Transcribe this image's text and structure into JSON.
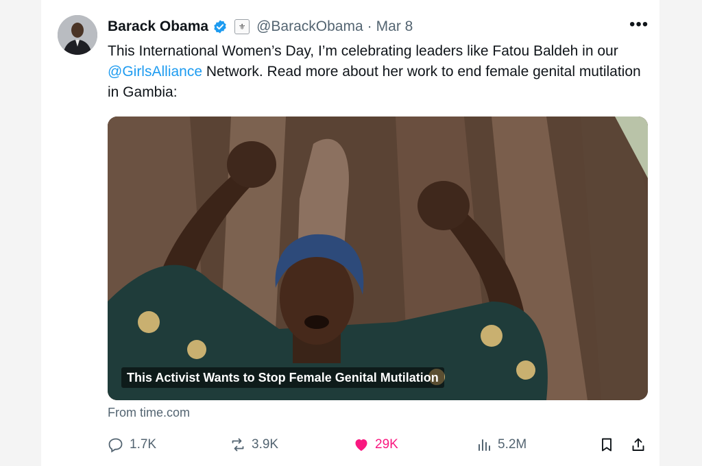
{
  "tweet": {
    "author_name": "Barack Obama",
    "handle": "@BarackObama",
    "separator": "·",
    "date": "Mar 8",
    "more_label": "•••",
    "text_before_mention": "This International Women’s Day, I’m celebrating leaders like Fatou Baldeh in our ",
    "mention": "@GirlsAlliance",
    "text_after_mention": " Network. Read more about her work to end female genital mutilation in Gambia:"
  },
  "media": {
    "caption": "This Activist Wants to Stop Female Genital Mutilation",
    "source": "From time.com"
  },
  "actions": {
    "replies": "1.7K",
    "reposts": "3.9K",
    "likes": "29K",
    "views": "5.2M"
  },
  "colors": {
    "accent": "#1d9bf0",
    "like": "#f91880",
    "muted": "#536471"
  },
  "icons": {
    "verified": "verified-badge-icon",
    "government": "government-seal-icon",
    "reply": "reply-icon",
    "repost": "repost-icon",
    "like": "heart-icon",
    "views": "views-icon",
    "bookmark": "bookmark-icon",
    "share": "share-icon"
  }
}
